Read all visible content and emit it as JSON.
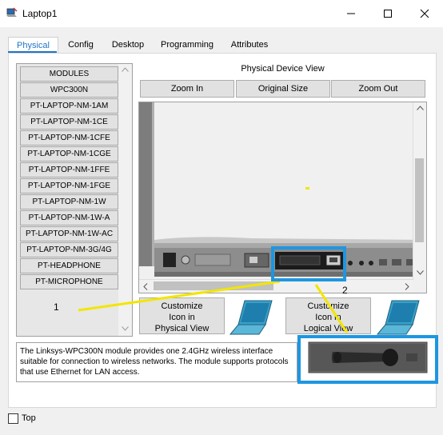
{
  "window": {
    "title": "Laptop1"
  },
  "tabs": [
    "Physical",
    "Config",
    "Desktop",
    "Programming",
    "Attributes"
  ],
  "modules": [
    "MODULES",
    "WPC300N",
    "PT-LAPTOP-NM-1AM",
    "PT-LAPTOP-NM-1CE",
    "PT-LAPTOP-NM-1CFE",
    "PT-LAPTOP-NM-1CGE",
    "PT-LAPTOP-NM-1FFE",
    "PT-LAPTOP-NM-1FGE",
    "PT-LAPTOP-NM-1W",
    "PT-LAPTOP-NM-1W-A",
    "PT-LAPTOP-NM-1W-AC",
    "PT-LAPTOP-NM-3G/4G",
    "PT-HEADPHONE",
    "PT-MICROPHONE"
  ],
  "physical_view": {
    "title": "Physical Device View",
    "zoom_in": "Zoom In",
    "original_size": "Original Size",
    "zoom_out": "Zoom Out"
  },
  "customize": {
    "physical": [
      "Customize",
      "Icon in",
      "Physical View"
    ],
    "logical": [
      "Customize",
      "Icon in",
      "Logical View"
    ]
  },
  "description": "The Linksys-WPC300N module provides one 2.4GHz wireless interface suitable for connection to wireless networks. The module supports protocols that use Ethernet for LAN access.",
  "annotations": {
    "label1": "1",
    "label2": "2"
  },
  "top_checkbox": {
    "label": "Top",
    "checked": false
  },
  "colors": {
    "tab_accent": "#1f74c9",
    "annotation_box": "#1e96e0",
    "annotation_line": "#f2e600"
  }
}
